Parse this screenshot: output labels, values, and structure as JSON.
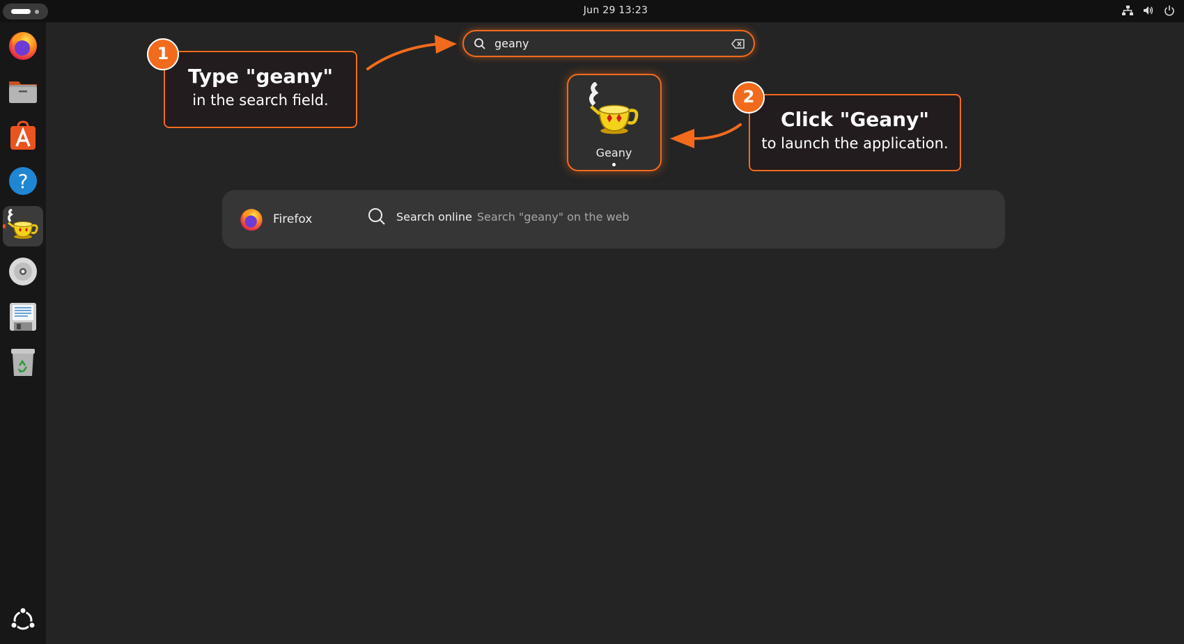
{
  "topbar": {
    "clock": "Jun 29  13:23",
    "tray_icons": [
      "network-icon",
      "volume-icon",
      "power-icon"
    ]
  },
  "dock": {
    "items": [
      {
        "name": "firefox",
        "icon": "firefox-icon",
        "active": false
      },
      {
        "name": "files",
        "icon": "folder-icon",
        "active": false
      },
      {
        "name": "app-center",
        "icon": "app-store-icon",
        "active": false
      },
      {
        "name": "help",
        "icon": "help-icon",
        "active": false
      },
      {
        "name": "geany",
        "icon": "geany-icon",
        "active": true
      },
      {
        "name": "disc",
        "icon": "disc-icon",
        "active": false
      },
      {
        "name": "writer",
        "icon": "floppy-document-icon",
        "active": false
      },
      {
        "name": "trash",
        "icon": "trash-icon",
        "active": false
      }
    ],
    "show_apps_icon": "ubuntu-logo-icon"
  },
  "search": {
    "value": "geany",
    "focused": true
  },
  "results": {
    "app": {
      "label": "Geany"
    },
    "providers": {
      "firefox_label": "Firefox",
      "online_title": "Search online",
      "online_desc": "Search \"geany\" on the web"
    }
  },
  "callouts": {
    "step1": {
      "number": "1",
      "heading": "Type  \"geany\"",
      "sub": "in the search field."
    },
    "step2": {
      "number": "2",
      "heading": "Click  \"Geany\"",
      "sub": "to launch the application."
    }
  },
  "colors": {
    "accent": "#f26b1d",
    "background": "#242424",
    "dock": "#171717",
    "topbar": "#111111",
    "panel": "#363636"
  }
}
